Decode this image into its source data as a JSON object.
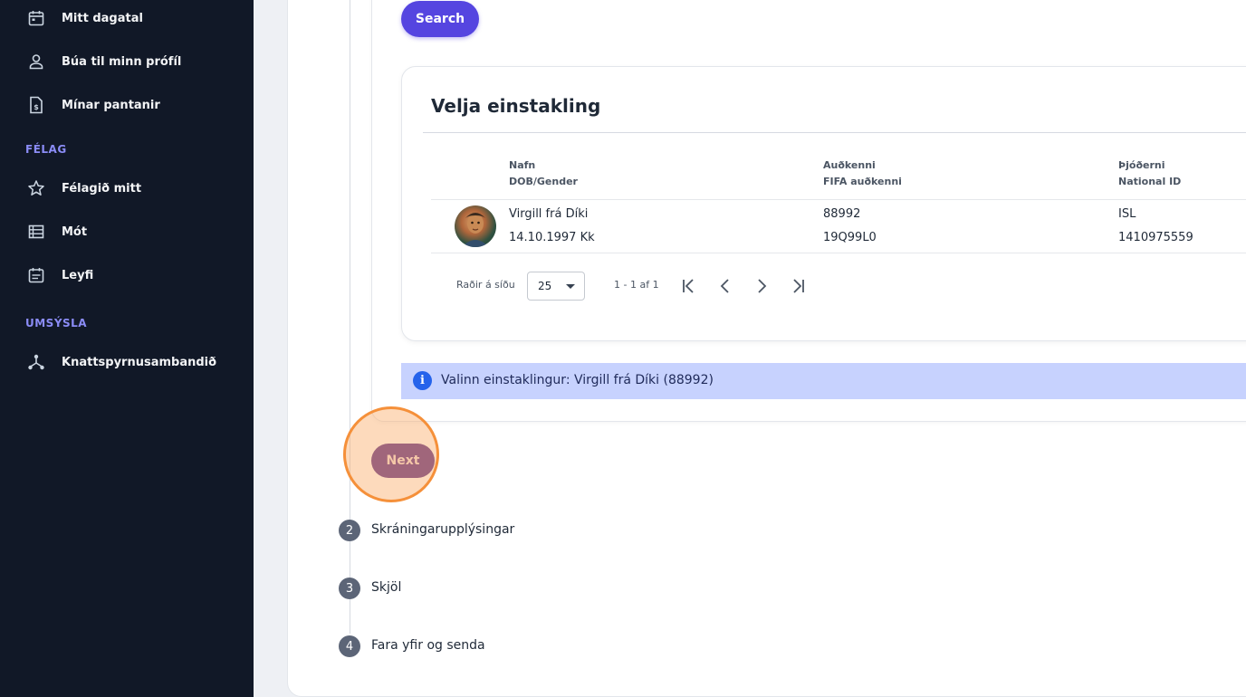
{
  "sidebar": {
    "items_top": [
      {
        "label": "Mitt dagatal",
        "icon": "calendar-icon"
      },
      {
        "label": "Búa til minn prófíl",
        "icon": "user-icon"
      },
      {
        "label": "Mínar pantanir",
        "icon": "invoice-icon"
      }
    ],
    "section_felag": "FÉLAG",
    "items_felag": [
      {
        "label": "Félagið mitt",
        "icon": "star-icon"
      },
      {
        "label": "Mót",
        "icon": "list-icon"
      },
      {
        "label": "Leyfi",
        "icon": "calendar-list-icon"
      }
    ],
    "section_umsysla": "UMSÝSLA",
    "items_umsysla": [
      {
        "label": "Knattspyrnusambandið",
        "icon": "network-icon"
      }
    ]
  },
  "search": {
    "button_label": "Search"
  },
  "select_person": {
    "title": "Velja einstakling",
    "columns": [
      {
        "line1": "Nafn",
        "line2": "DOB/Gender"
      },
      {
        "line1": "Auðkenni",
        "line2": "FIFA auðkenni"
      },
      {
        "line1": "Þjóðerni",
        "line2": "National ID"
      }
    ],
    "rows": [
      {
        "name": "Virgill frá Díki",
        "dob_gender": "14.10.1997 Kk",
        "id": "88992",
        "fifa_id": "19Q99L0",
        "nationality": "ISL",
        "national_id": "1410975559"
      }
    ],
    "pagination": {
      "rows_per_page_label": "Raðir á síðu",
      "rows_per_page_value": "25",
      "range": "1 - 1 af 1"
    }
  },
  "info": {
    "text": "Valinn einstaklingur: Virgill frá Díki (88992)"
  },
  "next_button": "Next",
  "steps": [
    {
      "num": "2",
      "label": "Skráningarupplýsingar"
    },
    {
      "num": "3",
      "label": "Skjöl"
    },
    {
      "num": "4",
      "label": "Fara yfir og senda"
    }
  ],
  "colors": {
    "sidebar_bg": "#111827",
    "section_heading": "#8b8cf6",
    "primary": "#5545e0",
    "info_bg": "#c7d2fe",
    "highlight": "#f5903a"
  }
}
